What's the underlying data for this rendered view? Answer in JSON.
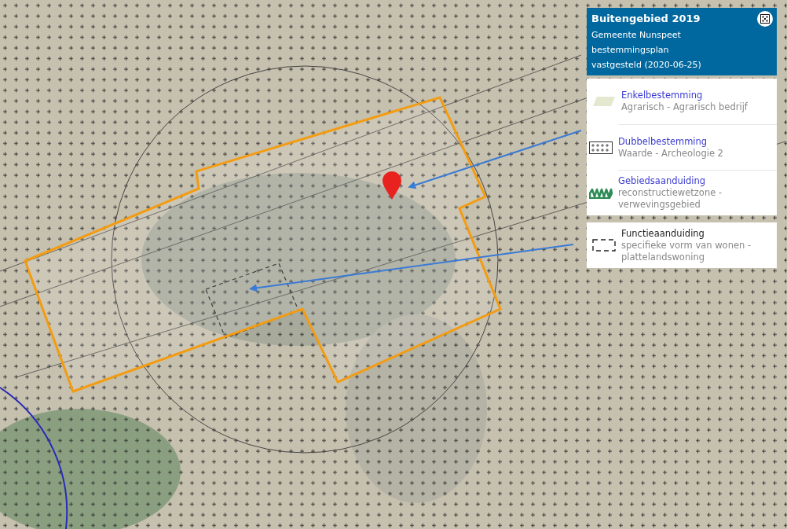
{
  "legend": {
    "title": "Buitengebied 2019",
    "subtitle_lines": [
      "Gemeente Nunspeet",
      "bestemmingsplan",
      "vastgesteld (2020-06-25)"
    ],
    "groups": [
      {
        "items": [
          {
            "kind": "fill",
            "is_link": true,
            "name": "Enkelbestemming",
            "description": "Agrarisch - Agrarisch bedrijf"
          },
          {
            "kind": "crosses",
            "is_link": true,
            "name": "Dubbelbestemming",
            "description": "Waarde - Archeologie 2"
          },
          {
            "kind": "zigzag",
            "is_link": true,
            "name": "Gebiedsaanduiding",
            "description": "reconstructiewetzone - verwevingsgebied"
          }
        ]
      },
      {
        "items": [
          {
            "kind": "dashed",
            "is_link": false,
            "name": "Functieaanduiding",
            "description": "specifieke vorm van wonen - plattelandswoning"
          }
        ]
      }
    ]
  }
}
